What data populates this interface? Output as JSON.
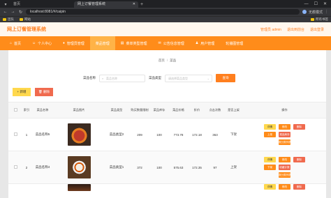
{
  "browser": {
    "tabs": [
      {
        "label": "首页",
        "active": false
      },
      {
        "label": "网上订餐管理系统",
        "active": true
      }
    ],
    "url": "localhost:8081/#/caipin",
    "profile_label": "无痕模式",
    "bookmarks": [
      "团队",
      "网站"
    ],
    "bookmarks_right": "所有书签"
  },
  "header": {
    "title": "网上订餐管理系统",
    "user": "管理员 admin",
    "links": [
      "退出到前台",
      "退出登录"
    ]
  },
  "nav": {
    "items": [
      {
        "label": "首页",
        "icon": "home-icon"
      },
      {
        "label": "个人中心",
        "icon": "user-icon"
      },
      {
        "label": "管理员管理",
        "icon": "admin-icon"
      },
      {
        "label": "菜品管理",
        "icon": "dish-icon",
        "active": true
      },
      {
        "label": "菜单类型管理",
        "icon": "menu-icon"
      },
      {
        "label": "公告信息管理",
        "icon": "notice-icon"
      },
      {
        "label": "用户管理",
        "icon": "users-icon"
      },
      {
        "label": "轮播图管理",
        "icon": "carousel-icon"
      }
    ]
  },
  "breadcrumb": {
    "home": "首页",
    "current": "菜品"
  },
  "search": {
    "name_label": "菜品名称",
    "name_placeholder": "菜品名称",
    "type_label": "菜品类型",
    "type_placeholder": "请选择菜品类型",
    "button": "查询"
  },
  "actions": {
    "add": "新增",
    "delete": "删除"
  },
  "table": {
    "headers": [
      "索引",
      "菜品名称",
      "菜品图片",
      "菜品类型",
      "购买数量限制",
      "菜品库存",
      "菜品价格",
      "折价",
      "点击次数",
      "是否上架",
      "操作"
    ],
    "rows": [
      {
        "index": "1",
        "name": "菜品名称5",
        "type": "菜品类型2",
        "limit": "209",
        "stock": "100",
        "price": "773.78",
        "discount": "172.18",
        "clicks": "363",
        "status": "下架"
      },
      {
        "index": "2",
        "name": "菜品名称4",
        "type": "菜品类型1",
        "limit": "372",
        "stock": "100",
        "price": "575.63",
        "discount": "172.35",
        "clicks": "97",
        "status": "上架"
      }
    ],
    "ops": [
      "详情",
      "修改",
      "删除",
      "上架",
      "菜品库存",
      "下架",
      "收藏计数",
      "数分类列表"
    ]
  },
  "colors": {
    "primary": "#ff8c1a",
    "title": "#ff7f1e",
    "add": "#ffd84d",
    "delete": "#f06a4e"
  }
}
